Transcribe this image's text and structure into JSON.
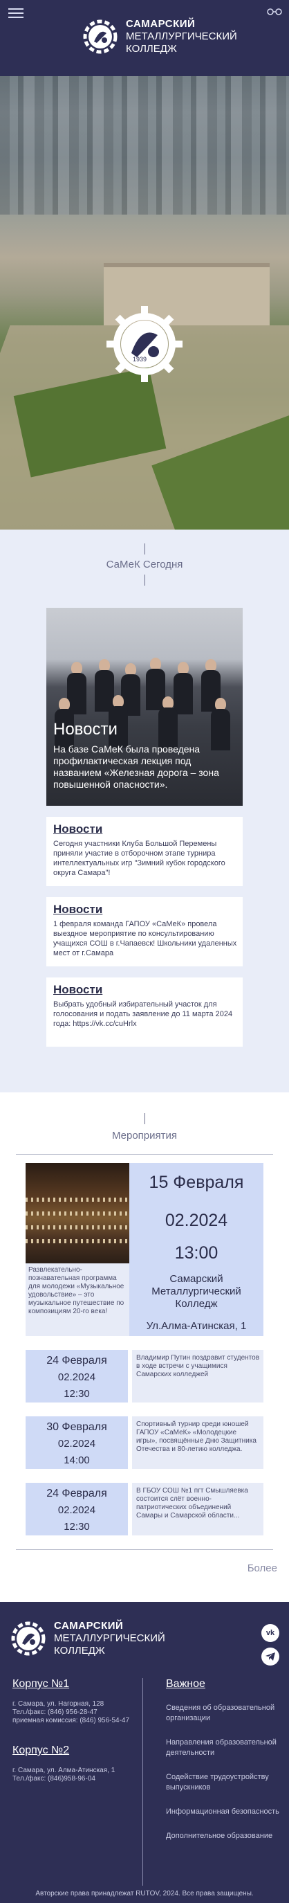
{
  "header": {
    "college_name_line1": "САМАРСКИЙ",
    "college_name_line2": "МЕТАЛЛУРГИЧЕСКИЙ",
    "college_name_line3": "КОЛЛЕДЖ",
    "menu_icon": "hamburger-menu-icon",
    "accessibility_icon": "glasses-icon"
  },
  "hero": {
    "emblem_text": "1939"
  },
  "news": {
    "section_title": "СаМеК Сегодня",
    "featured": {
      "title": "Новости",
      "text": "На базе СаМеК была проведена профилактическая лекция под названием «Железная дорога – зона повышенной опасности»."
    },
    "cards": [
      {
        "title": "Новости",
        "text": "Сегодня участники Клуба Большой Перемены приняли участие в отборочном этапе турнира интеллектуальных игр \"Зимний кубок городского округа Самара\"!"
      },
      {
        "title": "Новости",
        "text": "1 февраля команда ГАПОУ «СаМеК» провела выездное мероприятие по консультированию учащихся СОШ в г.Чапаевск! Школьники удаленных мест от г.Самара"
      },
      {
        "title": "Новости",
        "text": "Выбрать удобный избирательный участок для голосования и подать заявление до 11 марта 2024 года: https://vk.cc/cuHrlx"
      }
    ]
  },
  "events": {
    "section_title": "Мероприятия",
    "main": {
      "day": "15 Февраля",
      "year": "02.2024",
      "time": "13:00",
      "place": "Самарский Металлургический Колледж",
      "address": "Ул.Алма-Атинская, 1",
      "description": "Развлекательно-познавательная программа для молодежи «Музыкальное удовольствие» – это музыкальное путешествие по композициям 20-го века!"
    },
    "list": [
      {
        "day": "24 Февраля",
        "year": "02.2024",
        "time": "12:30",
        "text": "Владимир Путин поздравит студентов в ходе встречи с учащимися Самарских колледжей"
      },
      {
        "day": "30 Февраля",
        "year": "02.2024",
        "time": "14:00",
        "text": "Спортивный турнир среди юношей ГАПОУ «СаМеК» «Молодецкие игры», посвящённые Дню Защитника Отечества и 80-летию колледжа."
      },
      {
        "day": "24 Февраля",
        "year": "02.2024",
        "time": "12:30",
        "text": "В ГБОУ СОШ №1 пгт Смышляевка состоится слёт военно-патриотических объединений Самары и Самарской области..."
      }
    ],
    "more_label": "Более"
  },
  "footer": {
    "college_name_line1": "САМАРСКИЙ",
    "college_name_line2": "МЕТАЛЛУРГИЧЕСКИЙ",
    "college_name_line3": "КОЛЛЕДЖ",
    "social": [
      "vk-icon",
      "telegram-icon"
    ],
    "campus1": {
      "title": "Корпус №1",
      "addr1": "г. Самара, ул. Нагорная, 128",
      "addr2": "Тел./факс: (846) 956-28-47",
      "addr3": "приемная комиссия: (846) 956-54-47"
    },
    "campus2": {
      "title": "Корпус №2",
      "addr1": "г. Самара, ул. Алма-Атинская, 1",
      "addr2": "Тел./факс: (846)958-96-04"
    },
    "links_title": "Важное",
    "links": [
      "Сведения об образовательной организации",
      "Направления образовательной деятельности",
      "Содействие трудоустройству выпускников",
      "Информационная безопасность",
      "Дополнительное образование"
    ],
    "copyright": "Авторские права принадлежат RUTOV, 2024. Все права защищены."
  }
}
